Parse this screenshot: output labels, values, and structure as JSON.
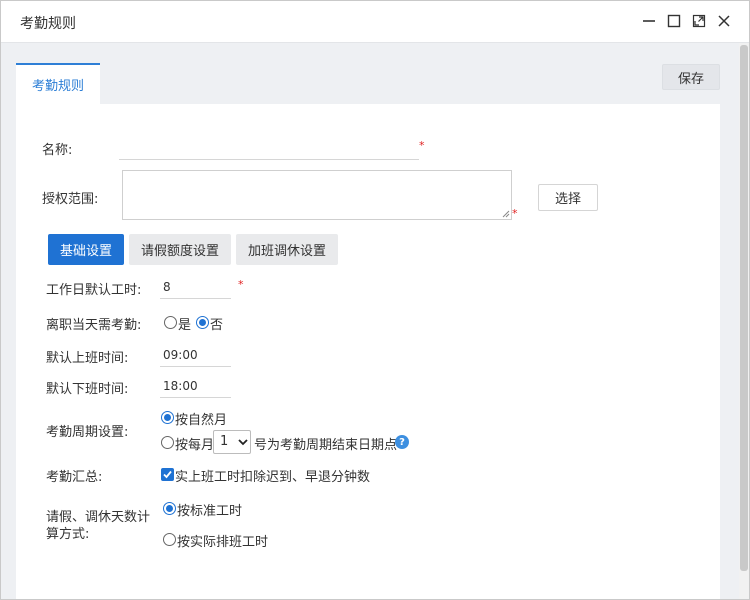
{
  "window": {
    "title": "考勤规则",
    "controls": [
      "minimize-icon",
      "maximize-icon",
      "restore-icon",
      "close-icon"
    ]
  },
  "tabs": [
    {
      "label": "考勤规则",
      "active": true
    }
  ],
  "toolbar": {
    "save_label": "保存"
  },
  "form": {
    "name_label": "名称:",
    "name_value": "",
    "scope_label": "授权范围:",
    "scope_value": "",
    "choose_label": "选择",
    "required_mark": "*"
  },
  "subtabs": [
    {
      "label": "基础设置",
      "active": true
    },
    {
      "label": "请假额度设置",
      "active": false
    },
    {
      "label": "加班调休设置",
      "active": false
    }
  ],
  "basic": {
    "workhours_label": "工作日默认工时:",
    "workhours_value": "8",
    "resign_label": "离职当天需考勤:",
    "resign_yes": "是",
    "resign_no": "否",
    "resign_selected": "否",
    "start_label": "默认上班时间:",
    "start_value": "09:00",
    "end_label": "默认下班时间:",
    "end_value": "18:00",
    "cycle_label": "考勤周期设置:",
    "cycle_opt1": "按自然月",
    "cycle_opt2_pre": "按每月",
    "cycle_day": "1",
    "cycle_opt2_post": "号为考勤周期结束日期点",
    "cycle_selected": "按自然月",
    "summary_label": "考勤汇总:",
    "summary_check": "实上班工时扣除迟到、早退分钟数",
    "summary_checked": true,
    "leave_label_1": "请假、调休天数计",
    "leave_label_2": "算方式:",
    "leave_opt1": "按标准工时",
    "leave_opt2": "按实际排班工时",
    "leave_selected": "按标准工时"
  },
  "colors": {
    "accent": "#1f72d3",
    "required": "#e02020",
    "tab_text": "#2e7fd6"
  }
}
